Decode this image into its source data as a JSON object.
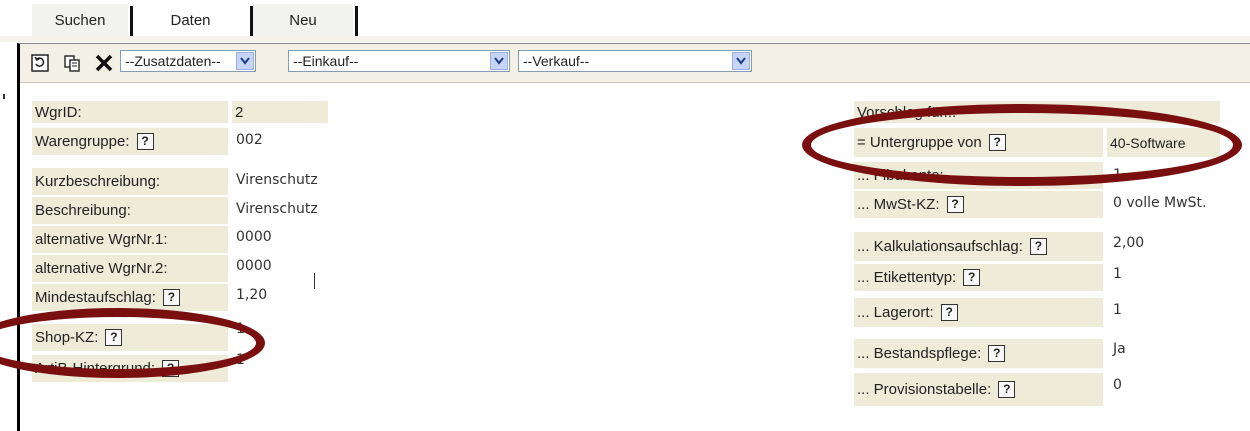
{
  "tabs": [
    {
      "label": "Suchen",
      "active": false
    },
    {
      "label": "Daten",
      "active": true
    },
    {
      "label": "Neu",
      "active": false
    }
  ],
  "toolbar": {
    "icons": [
      "refresh-icon",
      "copy-icon",
      "delete-icon"
    ],
    "selects": [
      {
        "value": "--Zusatzdaten--"
      },
      {
        "value": "--Einkauf--"
      },
      {
        "value": "--Verkauf--"
      }
    ]
  },
  "left_fields": [
    {
      "label": "WgrID:",
      "value": "2",
      "help": false
    },
    {
      "label": "Warengruppe:",
      "value": "002",
      "help": true
    },
    {
      "label": "Kurzbeschreibung:",
      "value": "Virenschutz",
      "help": false
    },
    {
      "label": "Beschreibung:",
      "value": "Virenschutz",
      "help": false
    },
    {
      "label": "alternative WgrNr.1:",
      "value": "0000",
      "help": false
    },
    {
      "label": "alternative WgrNr.2:",
      "value": "0000",
      "help": false
    },
    {
      "label": "Mindestaufschlag:",
      "value": "1,20",
      "help": true
    },
    {
      "label": "Shop-KZ:",
      "value": "1",
      "help": true
    },
    {
      "label": "ArtiB-Hintergrund:",
      "value": "1",
      "help": true
    }
  ],
  "right_section": {
    "header": "Vorschlag für...",
    "fields": [
      {
        "label": "= Untergruppe von",
        "value": "40-Software",
        "help": true
      },
      {
        "label": "... Fibukonto:",
        "value": "1",
        "help": false
      },
      {
        "label": "... MwSt-KZ:",
        "value": "0  volle MwSt.",
        "help": true
      },
      {
        "label": "... Kalkulationsaufschlag:",
        "value": "2,00",
        "help": true
      },
      {
        "label": "... Etikettentyp:",
        "value": "1",
        "help": true
      },
      {
        "label": "... Lagerort:",
        "value": "1",
        "help": true
      },
      {
        "label": "... Bestandspflege:",
        "value": "Ja",
        "help": true
      },
      {
        "label": "... Provisionstabelle:",
        "value": "0",
        "help": true
      }
    ]
  },
  "help_glyph": "?",
  "colors": {
    "highlight": "#7a0f0f",
    "label_bg": "#eeebd8",
    "toolbar_bg": "#f3f0e6"
  }
}
